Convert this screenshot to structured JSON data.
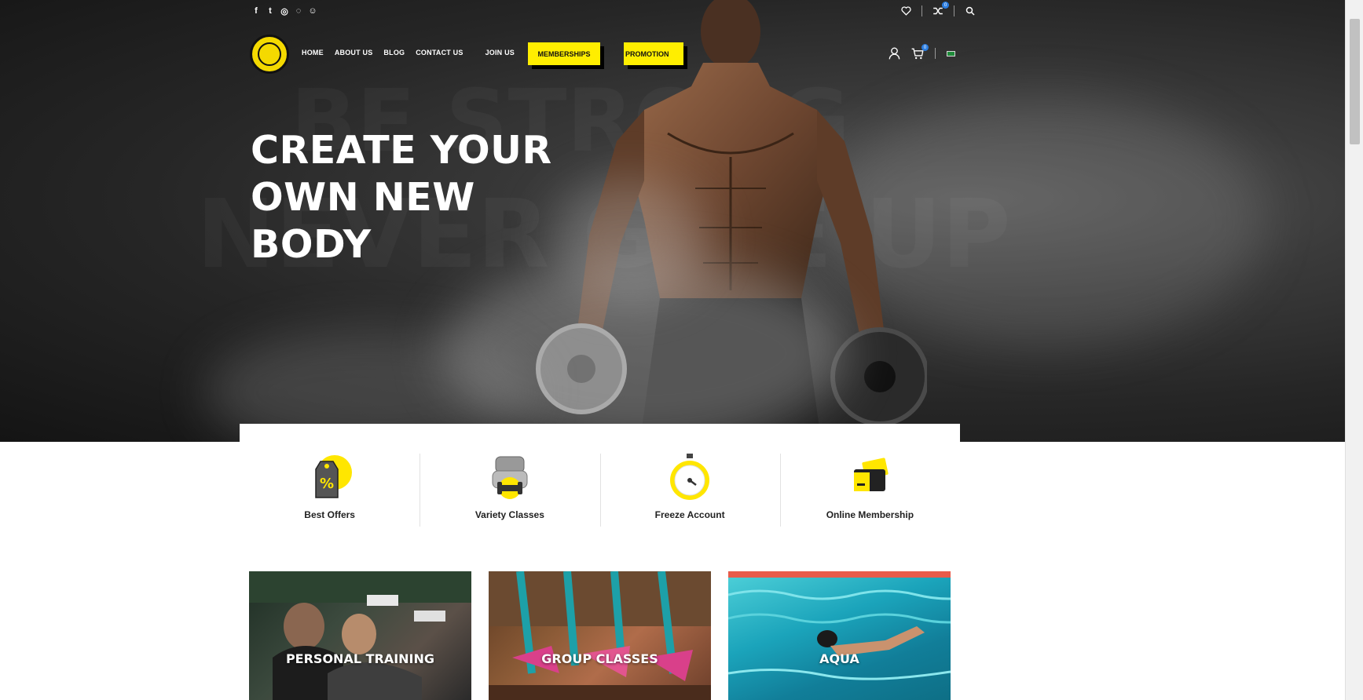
{
  "topbar": {
    "social_icons": [
      "facebook-icon",
      "twitter-icon",
      "instagram-icon",
      "whatsapp-icon",
      "snapchat-icon"
    ],
    "social_glyphs": [
      "f",
      "t",
      "◎",
      "◌",
      "☺"
    ],
    "compare_count": "0"
  },
  "brand": {
    "logo": "golds-gym-logo",
    "accent_color": "#ffee00"
  },
  "nav": {
    "home": "HOME",
    "about": "ABOUT US",
    "blog": "BLOG",
    "contact": "CONTACT US",
    "join": "JOIN US",
    "memberships": "MEMBERSHIPS",
    "promotion": "PROMOTION"
  },
  "header_tools": {
    "cart_count": "0"
  },
  "hero": {
    "title_line1": "CREATE YOUR",
    "title_line2": "OWN NEW",
    "title_line3": "BODY",
    "bg_word1": "BE STRONG",
    "bg_word2": "NEVER GIVE UP"
  },
  "features": [
    {
      "label": "Best Offers",
      "icon": "discount-tag-icon"
    },
    {
      "label": "Variety Classes",
      "icon": "dumbbell-icon"
    },
    {
      "label": "Freeze Account",
      "icon": "stopwatch-icon"
    },
    {
      "label": "Online Membership",
      "icon": "cards-icon"
    }
  ],
  "services": [
    {
      "title": "PERSONAL TRAINING"
    },
    {
      "title": "GROUP CLASSES"
    },
    {
      "title": "AQUA"
    }
  ]
}
